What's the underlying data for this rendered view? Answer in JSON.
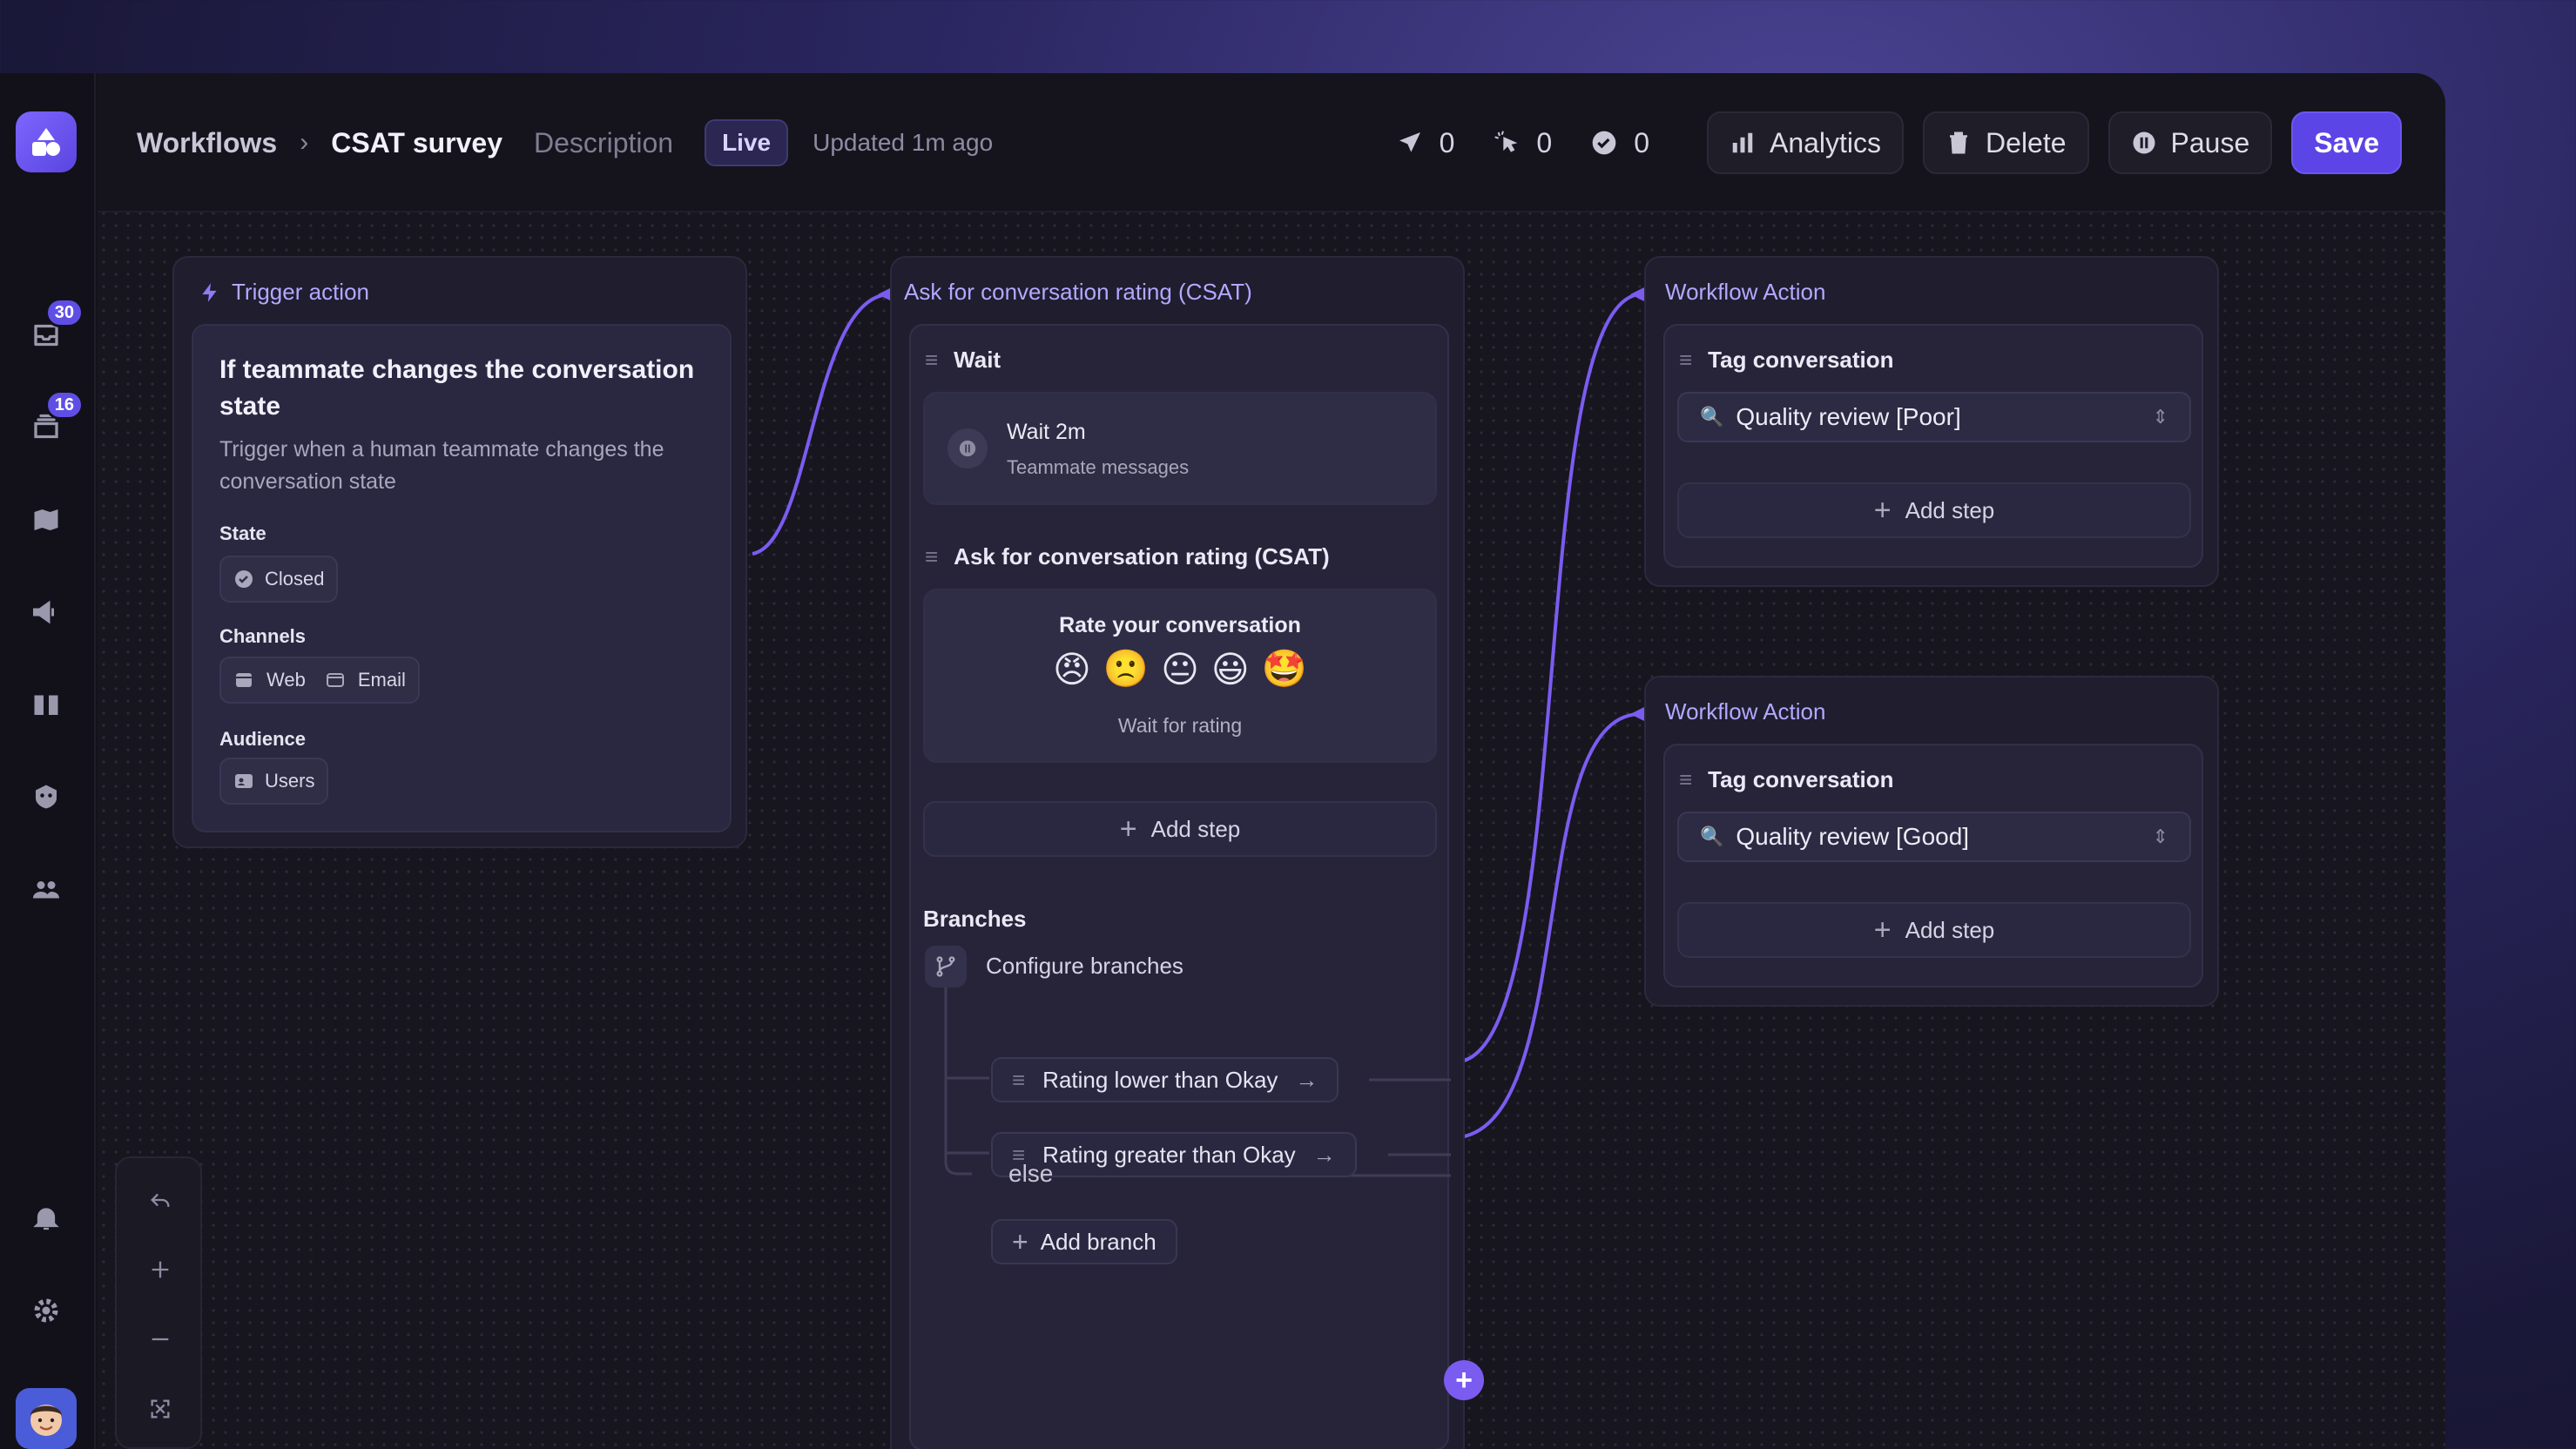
{
  "header": {
    "breadcrumb_root": "Workflows",
    "title": "CSAT survey",
    "description_label": "Description",
    "status_badge": "Live",
    "updated": "Updated 1m ago",
    "stats": {
      "sent": "0",
      "clicked": "0",
      "completed": "0"
    },
    "buttons": {
      "analytics": "Analytics",
      "delete": "Delete",
      "pause": "Pause",
      "save": "Save"
    }
  },
  "sidebar": {
    "badges": {
      "inbox": "30",
      "tickets": "16"
    },
    "icons": [
      "inbox-icon",
      "tickets-icon",
      "reports-icon",
      "outbound-icon",
      "knowledge-icon",
      "bot-icon",
      "contacts-icon",
      "bell-icon",
      "settings-icon"
    ]
  },
  "trigger": {
    "title": "Trigger action",
    "heading": "If teammate changes the conversation state",
    "description": "Trigger when a human teammate changes the conversation state",
    "state_label": "State",
    "state_value": "Closed",
    "channels_label": "Channels",
    "channels": [
      "Web",
      "Email"
    ],
    "audience_label": "Audience",
    "audience_value": "Users"
  },
  "csat": {
    "title": "Ask for conversation rating (CSAT)",
    "wait_label": "Wait",
    "wait_title": "Wait 2m",
    "wait_sub": "Teammate messages",
    "ask_label": "Ask for conversation rating (CSAT)",
    "rate_title": "Rate your conversation",
    "emojis": [
      "😠",
      "🙁",
      "😐",
      "😃",
      "🤩"
    ],
    "wait_rating": "Wait for rating",
    "add_step": "Add step",
    "branches_label": "Branches",
    "configure": "Configure branches",
    "branch_1": "Rating lower than Okay",
    "branch_2": "Rating greater than Okay",
    "add_branch": "Add branch",
    "else": "else"
  },
  "action_poor": {
    "title": "Workflow Action",
    "label": "Tag conversation",
    "value": "Quality review [Poor]",
    "add_step": "Add step"
  },
  "action_good": {
    "title": "Workflow Action",
    "label": "Tag conversation",
    "value": "Quality review [Good]",
    "add_step": "Add step"
  },
  "colors": {
    "accent": "#5b45e6",
    "link": "#7b5cf0",
    "title": "#b3a8ff"
  }
}
